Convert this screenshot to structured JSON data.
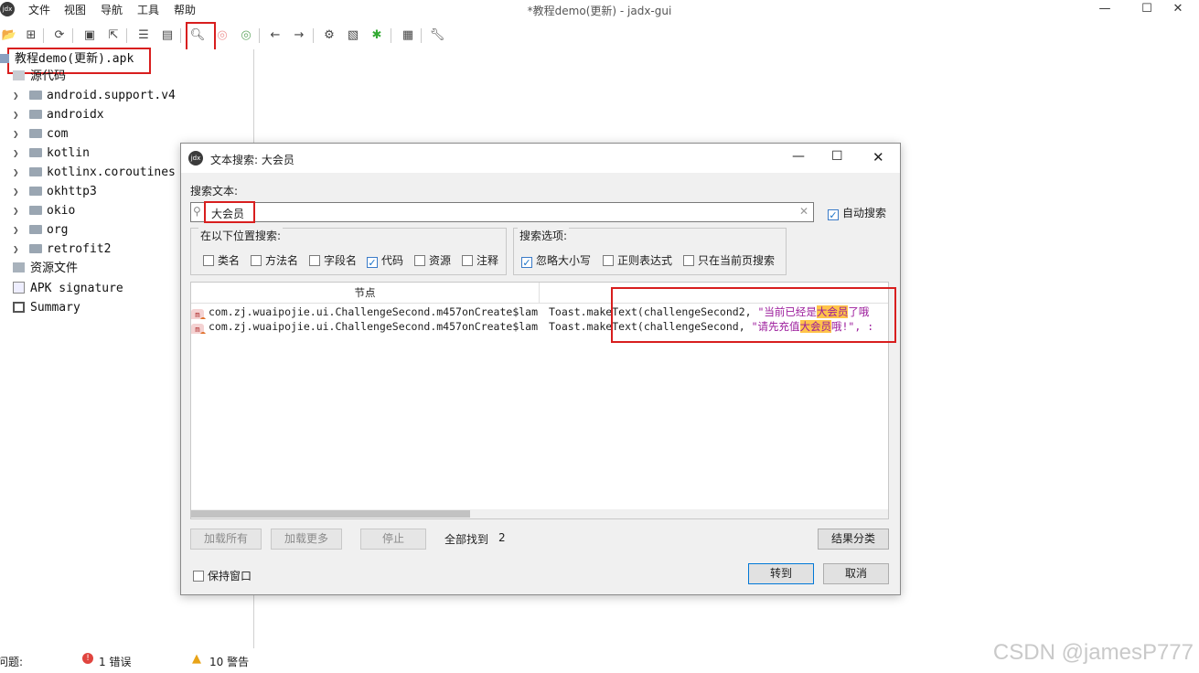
{
  "window": {
    "title": "*教程demo(更新) - jadx-gui",
    "menu": [
      "文件",
      "视图",
      "导航",
      "工具",
      "帮助"
    ],
    "controls": {
      "minimize": "—",
      "maximize": "☐",
      "close": "✕"
    }
  },
  "toolbar": {
    "icons": [
      "open-folder-icon",
      "add-files-icon",
      "sync-icon",
      "save-icon",
      "export-icon",
      "flatten-icon",
      "package-icon",
      "search-icon",
      "find-usage-icon",
      "deobfuscation-icon",
      "back-icon",
      "forward-icon",
      "quark-icon",
      "log-icon",
      "debug-icon",
      "notes-icon",
      "settings-icon"
    ]
  },
  "tree": {
    "root": "教程demo(更新).apk",
    "source_node": "源代码",
    "packages": [
      "android.support.v4",
      "androidx",
      "com",
      "kotlin",
      "kotlinx.coroutines",
      "okhttp3",
      "okio",
      "org",
      "retrofit2"
    ],
    "resources": "资源文件",
    "signature": "APK signature",
    "summary": "Summary"
  },
  "statusbar": {
    "problems_label": "问题:",
    "errors": "1 错误",
    "warnings": "10 警告"
  },
  "dialog": {
    "title": "文本搜索: 大会员",
    "search_label": "搜索文本:",
    "search_value": "大会员",
    "auto_search": {
      "label": "自动搜索",
      "checked": true
    },
    "search_in": {
      "title": "在以下位置搜索:",
      "options": [
        {
          "label": "类名",
          "checked": false
        },
        {
          "label": "方法名",
          "checked": false
        },
        {
          "label": "字段名",
          "checked": false
        },
        {
          "label": "代码",
          "checked": true
        },
        {
          "label": "资源",
          "checked": false
        },
        {
          "label": "注释",
          "checked": false
        }
      ]
    },
    "search_options": {
      "title": "搜索选项:",
      "options": [
        {
          "label": "忽略大小写",
          "checked": true
        },
        {
          "label": "正则表达式",
          "checked": false
        },
        {
          "label": "只在当前页搜索",
          "checked": false
        }
      ]
    },
    "results": {
      "column_node": "节点",
      "column_code": "",
      "rows": [
        {
          "node": "com.zj.wuaipojie.ui.ChallengeSecond.m457onCreate$lam",
          "code_prefix": "Toast.makeText(challengeSecond2, ",
          "str_before": "\"当前已经是",
          "match": "大会员",
          "str_after": "了哦"
        },
        {
          "node": "com.zj.wuaipojie.ui.ChallengeSecond.m457onCreate$lam",
          "code_prefix": "Toast.makeText(challengeSecond, ",
          "str_before": "\"请先充值",
          "match": "大会员",
          "str_after": "哦!\", :"
        }
      ]
    },
    "buttons": {
      "load_all": "加载所有",
      "load_more": "加载更多",
      "stop": "停止",
      "found_label": "全部找到",
      "found_count": "2",
      "group": "结果分类",
      "keep_window": "保持窗口",
      "goto": "转到",
      "cancel": "取消"
    }
  },
  "watermark": "CSDN @jamesP777"
}
